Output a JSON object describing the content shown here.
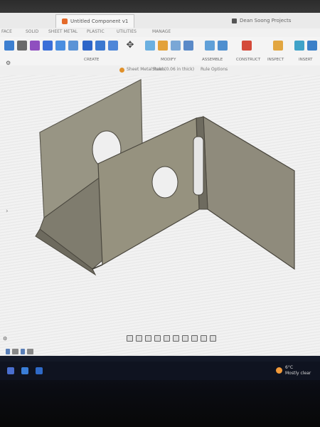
{
  "window": {
    "doc_tab_title": "Untitled Component v1",
    "right_tab_title": "Dean Soong Projects"
  },
  "menubar": {
    "items": [
      "FACE",
      "SOLID",
      "SHEET METAL",
      "PLASTIC",
      "UTILITIES",
      "MANAGE"
    ]
  },
  "ribbon": {
    "groups": [
      "CREATE",
      "MODIFY",
      "ASSEMBLE",
      "CONSTRUCT",
      "INSPECT",
      "INSERT"
    ]
  },
  "breadcrumb": {
    "item1": "Sheet Metal Rules",
    "item2": "Steel (0.06 in thick)",
    "item3": "Rule Options"
  },
  "viewport": {
    "model": "sheet-metal-bracket-with-holes"
  },
  "taskbar": {
    "weather_temp": "6°C",
    "weather_desc": "Mostly clear"
  },
  "colors": {
    "metal_face": "#8a8778",
    "metal_dark": "#5e5b50",
    "metal_light": "#a6a294",
    "viewport_bg": "#f2f2f2"
  }
}
